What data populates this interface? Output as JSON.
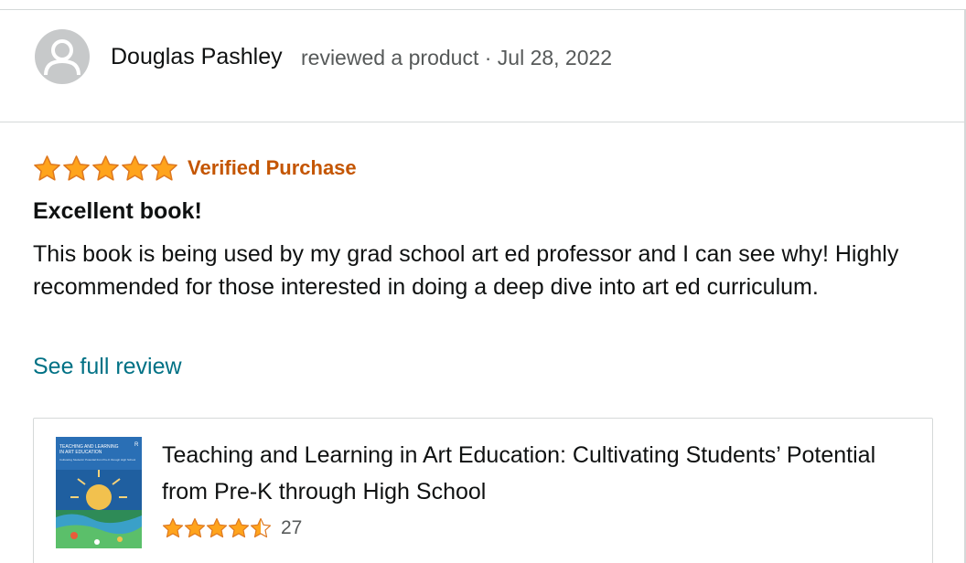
{
  "review": {
    "author": "Douglas Pashley",
    "meta": "reviewed a product · Jul 28, 2022",
    "rating": 5,
    "rating_max": 5,
    "verified_label": "Verified Purchase",
    "title": "Excellent book!",
    "body": "This book is being used by my grad school art ed professor and I can see why! Highly recommended for those interested in doing a deep dive into art ed curriculum.",
    "see_full_label": "See full review"
  },
  "product": {
    "title": "Teaching and Learning in Art Education: Cultivating Students’ Potential from Pre-K through High School",
    "rating": 4.5,
    "rating_count": "27",
    "cover_text": {
      "line1": "TEACHING AND LEARNING",
      "line2": "IN ART EDUCATION",
      "subtitle": "Cultivating Students' Potential from Pre-K through High School",
      "publisher_mark": "R"
    }
  },
  "colors": {
    "star": "#ffa41c",
    "star_outline": "#de7921",
    "verified": "#c45500",
    "link": "#007185",
    "meta_text": "#565959",
    "divider": "#d5d9d9"
  },
  "icons": {
    "avatar": "default-user-avatar-icon",
    "star": "star-icon",
    "half_star": "half-star-icon"
  }
}
